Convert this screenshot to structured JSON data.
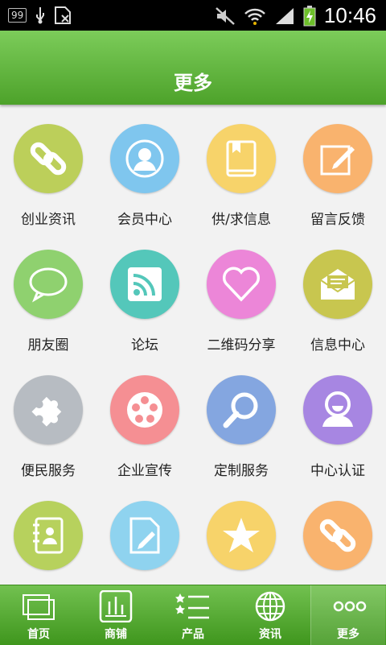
{
  "status_bar": {
    "badge": "99",
    "time": "10:46"
  },
  "header": {
    "title": "更多"
  },
  "tiles": [
    {
      "label": "创业资讯",
      "color": "#bccf5a",
      "icon": "chain-link-icon"
    },
    {
      "label": "会员中心",
      "color": "#7fc6ee",
      "icon": "member-avatar-icon"
    },
    {
      "label": "供/求信息",
      "color": "#f7d36a",
      "icon": "book-icon"
    },
    {
      "label": "留言反馈",
      "color": "#f9b36e",
      "icon": "pencil-note-icon"
    },
    {
      "label": "朋友圈",
      "color": "#8fd16f",
      "icon": "speech-bubble-icon"
    },
    {
      "label": "论坛",
      "color": "#54c7ba",
      "icon": "rss-icon"
    },
    {
      "label": "二维码分享",
      "color": "#ec86d8",
      "icon": "heart-icon"
    },
    {
      "label": "信息中心",
      "color": "#c8c64f",
      "icon": "envelope-icon"
    },
    {
      "label": "便民服务",
      "color": "#b7bcc2",
      "icon": "puzzle-icon"
    },
    {
      "label": "企业宣传",
      "color": "#f58f93",
      "icon": "film-reel-icon"
    },
    {
      "label": "定制服务",
      "color": "#84a6e0",
      "icon": "magnifier-icon"
    },
    {
      "label": "中心认证",
      "color": "#a786e2",
      "icon": "user-badge-icon"
    },
    {
      "label": "",
      "color": "#b7d15d",
      "icon": "contact-book-icon"
    },
    {
      "label": "",
      "color": "#8fd3ef",
      "icon": "document-edit-icon"
    },
    {
      "label": "",
      "color": "#f7d36a",
      "icon": "star-icon"
    },
    {
      "label": "",
      "color": "#f9b36e",
      "icon": "chain-link-icon"
    }
  ],
  "tabs": [
    {
      "label": "首页",
      "icon": "home-windows-icon"
    },
    {
      "label": "商铺",
      "icon": "shop-bars-icon"
    },
    {
      "label": "产品",
      "icon": "product-list-icon"
    },
    {
      "label": "资讯",
      "icon": "globe-icon"
    },
    {
      "label": "更多",
      "icon": "more-dots-icon"
    }
  ]
}
